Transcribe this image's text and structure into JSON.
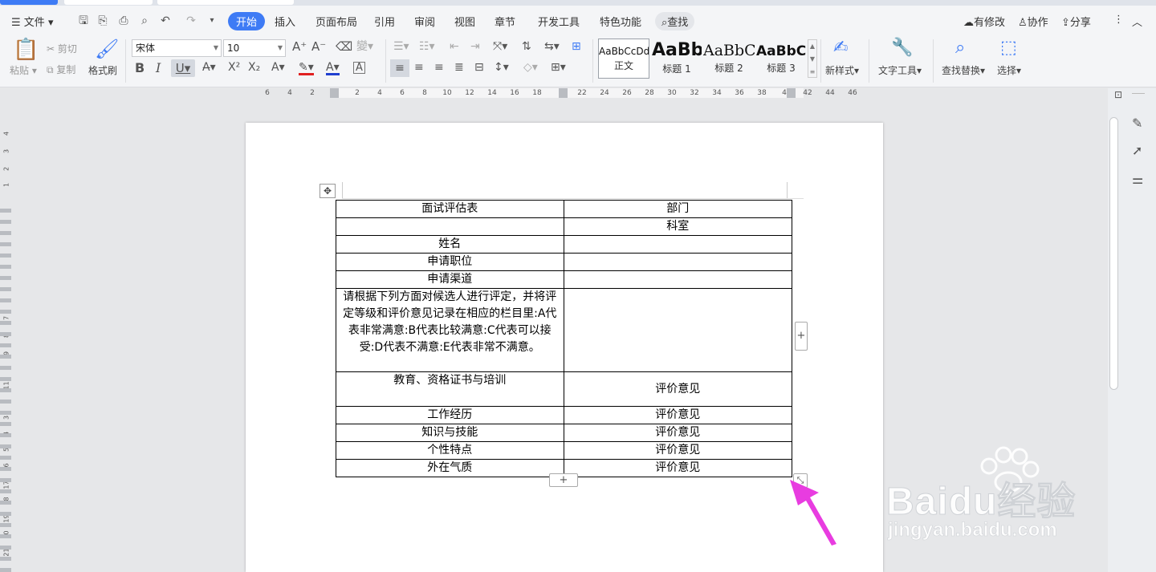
{
  "menubar": {
    "file": "文件",
    "tabs": [
      "开始",
      "插入",
      "页面布局",
      "引用",
      "审阅",
      "视图",
      "章节",
      "开发工具",
      "特色功能"
    ],
    "search": "查找",
    "right": {
      "modified": "有修改",
      "collab": "协作",
      "share": "分享"
    }
  },
  "ribbon": {
    "paste": "粘贴",
    "cut": "剪切",
    "copy": "复制",
    "format_painter": "格式刷",
    "font_name": "宋体",
    "font_size": "10",
    "styles": [
      {
        "preview": "AaBbCcDd",
        "name": "正文"
      },
      {
        "preview": "AaBb",
        "name": "标题 1"
      },
      {
        "preview": "AaBbC",
        "name": "标题 2"
      },
      {
        "preview": "AaBbC",
        "name": "标题 3"
      }
    ],
    "new_style": "新样式",
    "text_tools": "文字工具",
    "find_replace": "查找替换",
    "select": "选择"
  },
  "ruler": {
    "marks": [
      "6",
      "4",
      "2",
      "2",
      "4",
      "6",
      "8",
      "10",
      "12",
      "14",
      "16",
      "18",
      "22",
      "24",
      "26",
      "28",
      "30",
      "32",
      "34",
      "36",
      "38",
      "4",
      "42",
      "44",
      "46"
    ],
    "vmarks": [
      "4",
      "3",
      "2",
      "1",
      "6",
      "7",
      "8",
      "9",
      "11",
      "2",
      "3",
      "4",
      "5",
      "16",
      "17",
      "18",
      "19",
      "20",
      "21"
    ]
  },
  "table": {
    "rows": [
      {
        "left": "面试评估表",
        "right": "部门"
      },
      {
        "left": "",
        "right": "科室"
      },
      {
        "left": "姓名",
        "right": ""
      },
      {
        "left": "申请职位",
        "right": ""
      },
      {
        "left": "申请渠道",
        "right": ""
      },
      {
        "left": "请根据下列方面对候选人进行评定，并将评定等级和评价意见记录在相应的栏目里:A代表非常满意:B代表比较满意:C代表可以接受:D代表不满意:E代表非常不满意。",
        "right": ""
      },
      {
        "left": "教育、资格证书与培训",
        "right": "评价意见"
      },
      {
        "left": "工作经历",
        "right": "评价意见"
      },
      {
        "left": "知识与技能",
        "right": "评价意见"
      },
      {
        "left": "个性特点",
        "right": "评价意见"
      },
      {
        "left": "外在气质",
        "right": "评价意见"
      }
    ]
  },
  "watermark": {
    "brand": "Baidu经验",
    "url": "jingyan.baidu.com"
  },
  "colors": {
    "accent": "#3e7bf5",
    "arrow": "#e83ce0",
    "font_color": "#1f3fd0",
    "highlight": "#e02020"
  }
}
